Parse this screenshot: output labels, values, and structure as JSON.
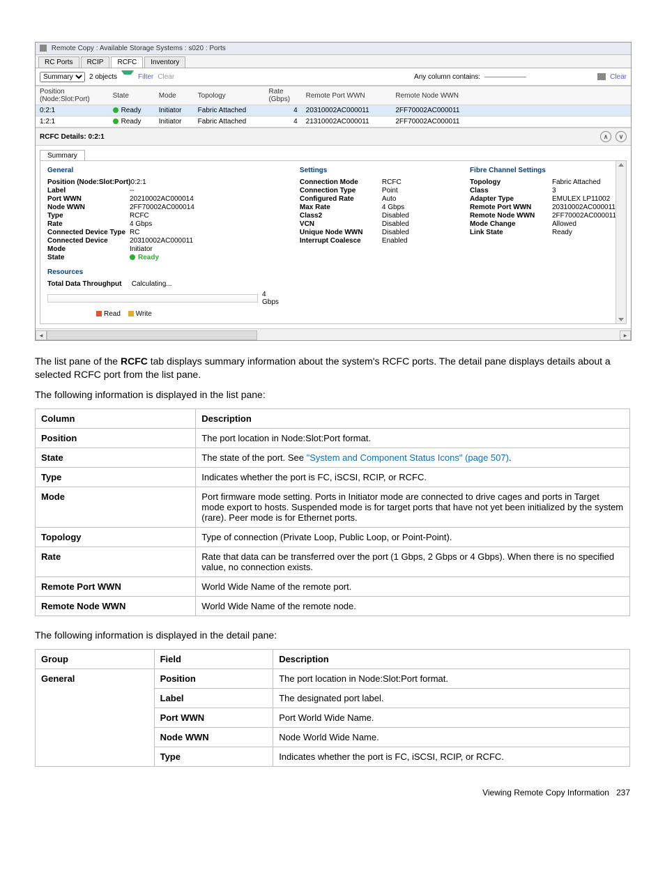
{
  "screenshot": {
    "windowTitle": "Remote Copy : Available Storage Systems : s020 : Ports",
    "topTabs": [
      "RC Ports",
      "RCIP",
      "RCFC",
      "Inventory"
    ],
    "activeTopTab": "RCFC",
    "toolbar": {
      "viewSelect": "Summary",
      "objects": "2 objects",
      "filter": "Filter",
      "clear": "Clear",
      "searchLabel": "Any column contains:",
      "rightClear": "Clear"
    },
    "columns": [
      "Position\n(Node:Slot:Port)",
      "State",
      "Mode",
      "Topology",
      "Rate\n(Gbps)",
      "Remote Port WWN",
      "Remote Node WWN"
    ],
    "rows": [
      {
        "pos": "0:2:1",
        "state": "Ready",
        "mode": "Initiator",
        "topology": "Fabric Attached",
        "rate": "4",
        "rportwwn": "20310002AC000011",
        "rnodewwn": "2FF70002AC000011",
        "selected": true
      },
      {
        "pos": "1:2:1",
        "state": "Ready",
        "mode": "Initiator",
        "topology": "Fabric Attached",
        "rate": "4",
        "rportwwn": "21310002AC000011",
        "rnodewwn": "2FF70002AC000011",
        "selected": false
      }
    ],
    "detailsTitle": "RCFC Details: 0:2:1",
    "innerTab": "Summary",
    "sections": {
      "general": {
        "heading": "General",
        "items": [
          {
            "k": "Position (Node:Slot:Port)",
            "v": "0:2:1"
          },
          {
            "k": "Label",
            "v": "--"
          },
          {
            "k": "Port WWN",
            "v": "20210002AC000014"
          },
          {
            "k": "Node WWN",
            "v": "2FF70002AC000014"
          },
          {
            "k": "Type",
            "v": "RCFC"
          },
          {
            "k": "Rate",
            "v": "4 Gbps"
          },
          {
            "k": "Connected Device Type",
            "v": "RC"
          },
          {
            "k": "Connected Device",
            "v": "20310002AC000011"
          },
          {
            "k": "Mode",
            "v": "Initiator"
          },
          {
            "k": "State",
            "v": "Ready",
            "ready": true
          }
        ]
      },
      "settings": {
        "heading": "Settings",
        "items": [
          {
            "k": "Connection Mode",
            "v": "RCFC"
          },
          {
            "k": "Connection Type",
            "v": "Point"
          },
          {
            "k": "Configured Rate",
            "v": "Auto"
          },
          {
            "k": "Max Rate",
            "v": "4 Gbps"
          },
          {
            "k": "Class2",
            "v": "Disabled"
          },
          {
            "k": "VCN",
            "v": "Disabled"
          },
          {
            "k": "Unique Node WWN",
            "v": "Disabled"
          },
          {
            "k": "Interrupt Coalesce",
            "v": "Enabled"
          }
        ]
      },
      "fibre": {
        "heading": "Fibre Channel Settings",
        "items": [
          {
            "k": "Topology",
            "v": "Fabric Attached"
          },
          {
            "k": "Class",
            "v": "3"
          },
          {
            "k": "Adapter Type",
            "v": "EMULEX LP11002"
          },
          {
            "k": "Remote Port WWN",
            "v": "20310002AC000011"
          },
          {
            "k": "Remote Node WWN",
            "v": "2FF70002AC000011"
          },
          {
            "k": "Mode Change",
            "v": "Allowed"
          },
          {
            "k": "Link State",
            "v": "Ready"
          }
        ]
      },
      "resources": {
        "heading": "Resources",
        "throughputLabel": "Total Data Throughput",
        "throughputValue": "Calculating...",
        "barMax": "4 Gbps",
        "legendRead": "Read",
        "legendWrite": "Write"
      }
    }
  },
  "doc": {
    "para1_a": "The list pane of the ",
    "para1_b": "RCFC",
    "para1_c": " tab displays summary information about the system's RCFC ports. The detail pane displays details about a selected RCFC port from the list pane.",
    "para2": "The following information is displayed in the list pane:",
    "table1": {
      "headers": [
        "Column",
        "Description"
      ],
      "rows": [
        {
          "col": "Position",
          "desc": "The port location in Node:Slot:Port format."
        },
        {
          "col": "State",
          "desc_prefix": "The state of the port. See ",
          "link": "\"System and Component Status Icons\" (page 507)",
          "desc_suffix": "."
        },
        {
          "col": "Type",
          "desc": "Indicates whether the port is FC, iSCSI, RCIP, or RCFC."
        },
        {
          "col": "Mode",
          "desc": "Port firmware mode setting. Ports in Initiator mode are connected to drive cages and ports in Target mode export to hosts. Suspended mode is for target ports that have not yet been initialized by the system (rare). Peer mode is for Ethernet ports."
        },
        {
          "col": "Topology",
          "desc": "Type of connection (Private Loop, Public Loop, or Point-Point)."
        },
        {
          "col": "Rate",
          "desc": "Rate that data can be transferred over the port (1 Gbps, 2 Gbps or 4 Gbps). When there is no specified value, no connection exists."
        },
        {
          "col": "Remote Port WWN",
          "desc": "World Wide Name of the remote port."
        },
        {
          "col": "Remote Node WWN",
          "desc": "World Wide Name of the remote node."
        }
      ]
    },
    "para3": "The following information is displayed in the detail pane:",
    "table2": {
      "headers": [
        "Group",
        "Field",
        "Description"
      ],
      "group": "General",
      "rows": [
        {
          "field": "Position",
          "desc": "The port location in Node:Slot:Port format."
        },
        {
          "field": "Label",
          "desc": "The designated port label."
        },
        {
          "field": "Port WWN",
          "desc": "Port World Wide Name."
        },
        {
          "field": "Node WWN",
          "desc": "Node World Wide Name."
        },
        {
          "field": "Type",
          "desc": "Indicates whether the port is FC, iSCSI, RCIP, or RCFC."
        }
      ]
    },
    "footer": "Viewing Remote Copy Information",
    "pageNum": "237"
  }
}
